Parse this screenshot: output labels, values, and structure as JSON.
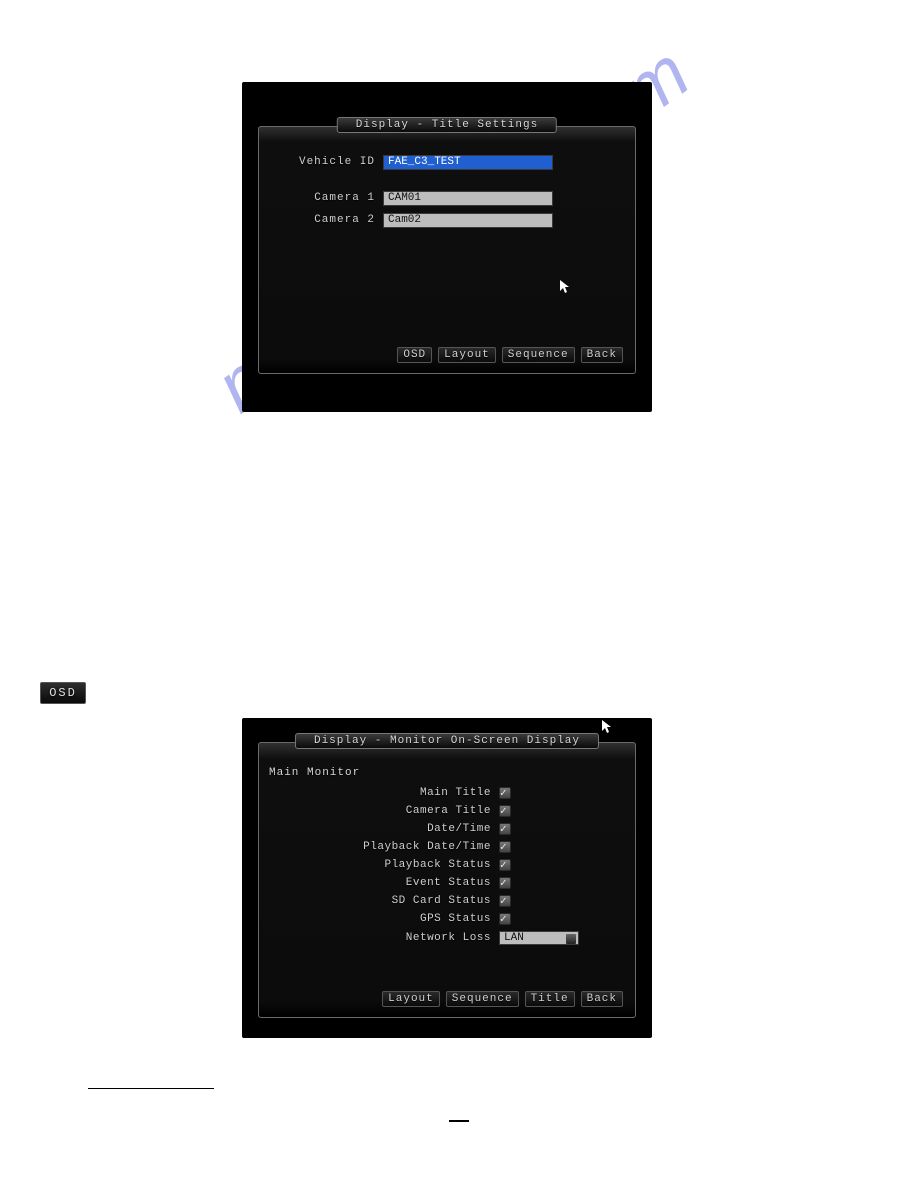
{
  "watermark": "manualshive.com",
  "screen1": {
    "title": "Display - Title Settings",
    "fields": {
      "vehicle_id": {
        "label": "Vehicle ID",
        "value": "FAE_C3_TEST"
      },
      "camera1": {
        "label": "Camera 1",
        "value": "CAM01"
      },
      "camera2": {
        "label": "Camera 2",
        "value": "Cam02"
      }
    },
    "nav": {
      "osd": "OSD",
      "layout": "Layout",
      "sequence": "Sequence",
      "back": "Back"
    }
  },
  "osd_label": "OSD",
  "screen2": {
    "title": "Display - Monitor On-Screen Display",
    "section": "Main Monitor",
    "checks": {
      "main_title": {
        "label": "Main Title",
        "checked": true
      },
      "camera_title": {
        "label": "Camera Title",
        "checked": true
      },
      "date_time": {
        "label": "Date/Time",
        "checked": true
      },
      "playback_date_time": {
        "label": "Playback Date/Time",
        "checked": true
      },
      "playback_status": {
        "label": "Playback Status",
        "checked": true
      },
      "event_status": {
        "label": "Event Status",
        "checked": true
      },
      "sd_card_status": {
        "label": "SD Card Status",
        "checked": true
      },
      "gps_status": {
        "label": "GPS Status",
        "checked": true
      }
    },
    "network_loss": {
      "label": "Network Loss",
      "value": "LAN"
    },
    "nav": {
      "layout": "Layout",
      "sequence": "Sequence",
      "title": "Title",
      "back": "Back"
    }
  }
}
